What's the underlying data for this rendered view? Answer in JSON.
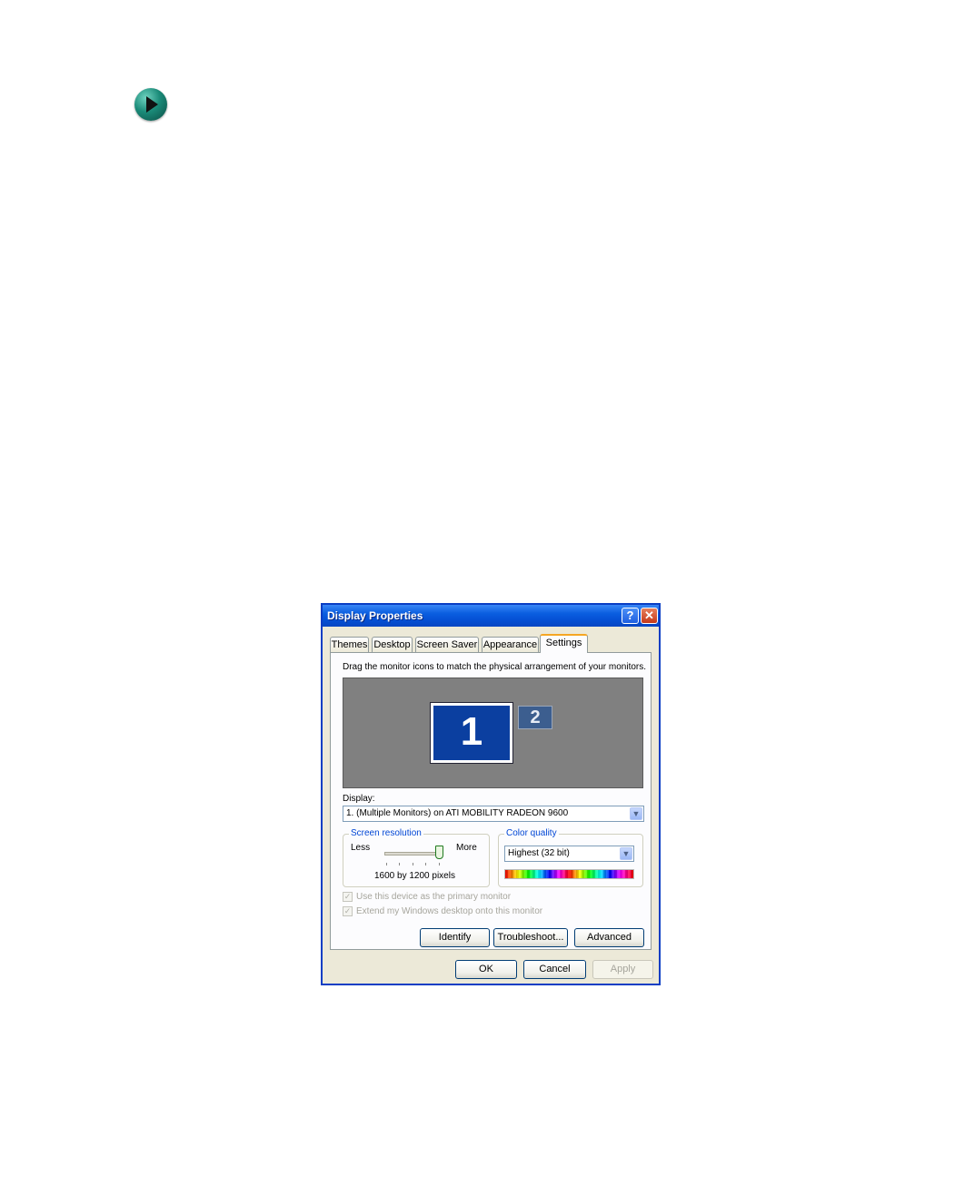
{
  "window": {
    "title": "Display Properties",
    "help_glyph": "?",
    "close_glyph": "✕"
  },
  "tabs": [
    {
      "label": "Themes",
      "active": false
    },
    {
      "label": "Desktop",
      "active": false
    },
    {
      "label": "Screen Saver",
      "active": false
    },
    {
      "label": "Appearance",
      "active": false
    },
    {
      "label": "Settings",
      "active": true
    }
  ],
  "settings": {
    "instruction": "Drag the monitor icons to match the physical arrangement of your monitors.",
    "monitors": [
      {
        "number": "1",
        "primary": true
      },
      {
        "number": "2",
        "primary": false
      }
    ],
    "display_label": "Display:",
    "display_value": "1. (Multiple Monitors) on ATI MOBILITY RADEON 9600",
    "screen_resolution": {
      "title": "Screen resolution",
      "less_label": "Less",
      "more_label": "More",
      "value_text": "1600 by 1200 pixels",
      "slider_position": 1.0
    },
    "color_quality": {
      "title": "Color quality",
      "value": "Highest (32 bit)"
    },
    "checkboxes": [
      {
        "label": "Use this device as the primary monitor",
        "checked": true,
        "enabled": false
      },
      {
        "label": "Extend my Windows desktop onto this monitor",
        "checked": true,
        "enabled": false
      }
    ],
    "buttons": {
      "identify": "Identify",
      "troubleshoot": "Troubleshoot...",
      "advanced": "Advanced"
    }
  },
  "footer": {
    "ok": "OK",
    "cancel": "Cancel",
    "apply": "Apply"
  },
  "colors": {
    "titlebar": "#0550d4",
    "monitor_primary": "#0b3fa0",
    "monitor_secondary": "#3c5e8f",
    "monitor_area": "#808080",
    "group_title": "#0046d5",
    "nav_arrow": "#1a8a78"
  },
  "icons": [
    "next-page-arrow-icon",
    "help-icon",
    "close-icon",
    "dropdown-arrow-icon",
    "checkmark-icon"
  ]
}
